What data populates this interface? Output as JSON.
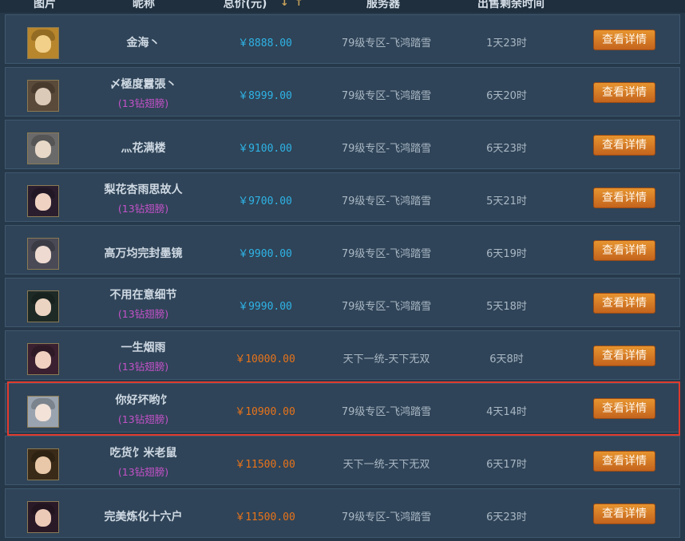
{
  "header": {
    "col_image": "图片",
    "col_nickname": "昵称",
    "col_price": "总价(元)",
    "sort_down_icon": "↓",
    "sort_up_icon": "↑",
    "col_server": "服务器",
    "col_remaining": "出售剩余时间"
  },
  "listing": {
    "detail_button_label": "查看详情",
    "rows": [
      {
        "nickname": "金海丶",
        "badge": "",
        "price": "￥8888.00",
        "price_color": "blue",
        "server": "79级专区-飞鸿踏雪",
        "remaining": "1天23时",
        "avatar": "avatar-1"
      },
      {
        "nickname": "〆極度囂張丶",
        "badge": "(13钻翅膀)",
        "price": "￥8999.00",
        "price_color": "blue",
        "server": "79级专区-飞鸿踏雪",
        "remaining": "6天20时",
        "avatar": "avatar-2"
      },
      {
        "nickname": "灬花满楼",
        "badge": "",
        "price": "￥9100.00",
        "price_color": "blue",
        "server": "79级专区-飞鸿踏雪",
        "remaining": "6天23时",
        "avatar": "avatar-3"
      },
      {
        "nickname": "梨花杏雨思故人",
        "badge": "(13钻翅膀)",
        "price": "￥9700.00",
        "price_color": "blue",
        "server": "79级专区-飞鸿踏雪",
        "remaining": "5天21时",
        "avatar": "avatar-4"
      },
      {
        "nickname": "高万均完封墨镜",
        "badge": "",
        "price": "￥9900.00",
        "price_color": "blue",
        "server": "79级专区-飞鸿踏雪",
        "remaining": "6天19时",
        "avatar": "avatar-5"
      },
      {
        "nickname": "不用在意细节",
        "badge": "(13钻翅膀)",
        "price": "￥9990.00",
        "price_color": "blue",
        "server": "79级专区-飞鸿踏雪",
        "remaining": "5天18时",
        "avatar": "avatar-6"
      },
      {
        "nickname": "一生烟雨",
        "badge": "(13钻翅膀)",
        "price": "￥10000.00",
        "price_color": "orange",
        "server": "天下一统-天下无双",
        "remaining": "6天8时",
        "avatar": "avatar-7"
      },
      {
        "nickname": "你好坏哟饣",
        "badge": "(13钻翅膀)",
        "price": "￥10900.00",
        "price_color": "orange",
        "server": "79级专区-飞鸿踏雪",
        "remaining": "4天14时",
        "avatar": "avatar-8"
      },
      {
        "nickname": "吃货饣米老鼠",
        "badge": "(13钻翅膀)",
        "price": "￥11500.00",
        "price_color": "orange",
        "server": "天下一统-天下无双",
        "remaining": "6天17时",
        "avatar": "avatar-9"
      },
      {
        "nickname": "完美炼化十六户",
        "badge": "",
        "price": "￥11500.00",
        "price_color": "orange",
        "server": "79级专区-飞鸿踏雪",
        "remaining": "6天23时",
        "avatar": "avatar-10"
      }
    ]
  },
  "colors": {
    "price_blue": "#2fb3e6",
    "price_orange": "#e8731a",
    "badge_purple": "#c452c9",
    "highlight_red": "#e13a2d",
    "button_orange": "#d87a24"
  }
}
